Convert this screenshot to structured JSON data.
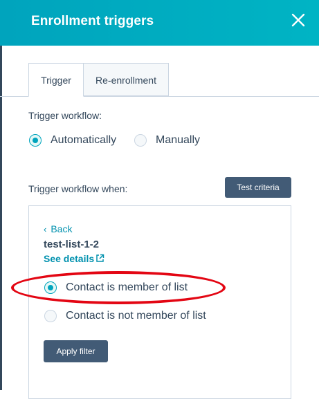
{
  "header": {
    "title": "Enrollment triggers",
    "close_icon": "close-icon"
  },
  "tabs": [
    {
      "label": "Trigger",
      "active": true
    },
    {
      "label": "Re-enrollment",
      "active": false
    }
  ],
  "trigger_workflow": {
    "label": "Trigger workflow:",
    "options": [
      {
        "label": "Automatically",
        "checked": true
      },
      {
        "label": "Manually",
        "checked": false
      }
    ]
  },
  "trigger_when": {
    "label": "Trigger workflow when:",
    "test_button": "Test criteria"
  },
  "filter": {
    "back": "Back",
    "list_name": "test-list-1-2",
    "see_details": "See details",
    "options": [
      {
        "label": "Contact is member of list",
        "checked": true
      },
      {
        "label": "Contact is not member of list",
        "checked": false
      }
    ],
    "apply_button": "Apply filter"
  },
  "colors": {
    "header": "#00a4bd",
    "accent": "#00a4bd",
    "link": "#0091ae",
    "button": "#425b76",
    "annotation": "#e30613"
  }
}
